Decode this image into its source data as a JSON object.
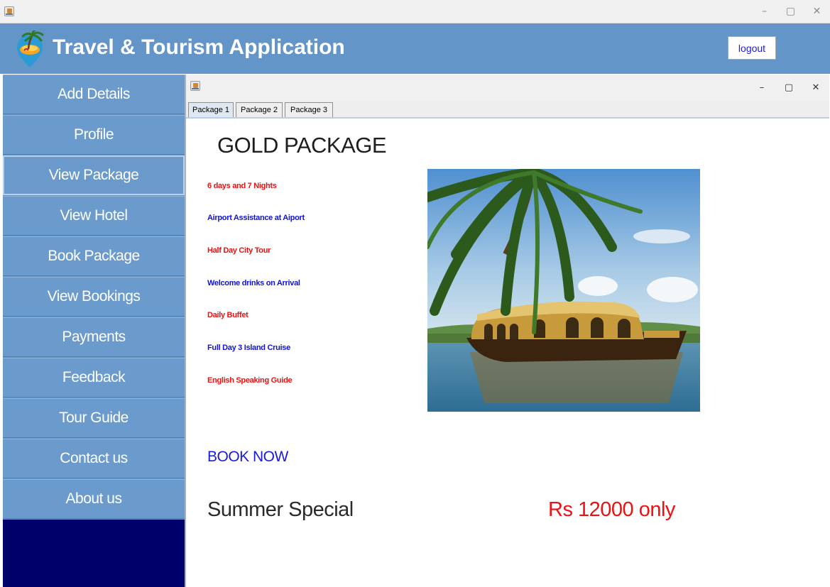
{
  "window": {
    "minimize_glyph": "–",
    "maximize_glyph": "▢",
    "close_glyph": "✕"
  },
  "header": {
    "title": "Travel & Tourism Application",
    "logout_label": "logout",
    "colors": {
      "header_bg": "#6395c8",
      "title": "#ffffff"
    }
  },
  "sidebar": {
    "items": [
      {
        "label": "Add Details"
      },
      {
        "label": "Profile"
      },
      {
        "label": "View Package",
        "active": true
      },
      {
        "label": "View Hotel"
      },
      {
        "label": "Book Package"
      },
      {
        "label": "View Bookings"
      },
      {
        "label": "Payments"
      },
      {
        "label": "Feedback"
      },
      {
        "label": "Tour Guide"
      },
      {
        "label": "Contact us"
      },
      {
        "label": "About us"
      }
    ],
    "colors": {
      "item_bg": "#6b9bcc",
      "footer_bg": "#00006b"
    }
  },
  "inner_window": {
    "minimize_glyph": "–",
    "maximize_glyph": "▢",
    "close_glyph": "✕",
    "tabs": [
      {
        "label": "Package 1",
        "selected": true
      },
      {
        "label": "Package 2"
      },
      {
        "label": "Package 3"
      }
    ]
  },
  "package": {
    "title": "GOLD PACKAGE",
    "features": [
      {
        "text": "6 days and 7 Nights",
        "color": "red"
      },
      {
        "text": "Airport Assistance at Aiport",
        "color": "blue"
      },
      {
        "text": "Half Day City Tour",
        "color": "red"
      },
      {
        "text": "Welcome drinks on Arrival",
        "color": "blue"
      },
      {
        "text": "Daily Buffet",
        "color": "red"
      },
      {
        "text": "Full Day 3 Island Cruise",
        "color": "blue"
      },
      {
        "text": "English Speaking Guide",
        "color": "red"
      }
    ],
    "book_now": "BOOK NOW",
    "promo": "Summer Special",
    "price": "Rs 12000 only",
    "image": "houseboat-palm-photo"
  }
}
